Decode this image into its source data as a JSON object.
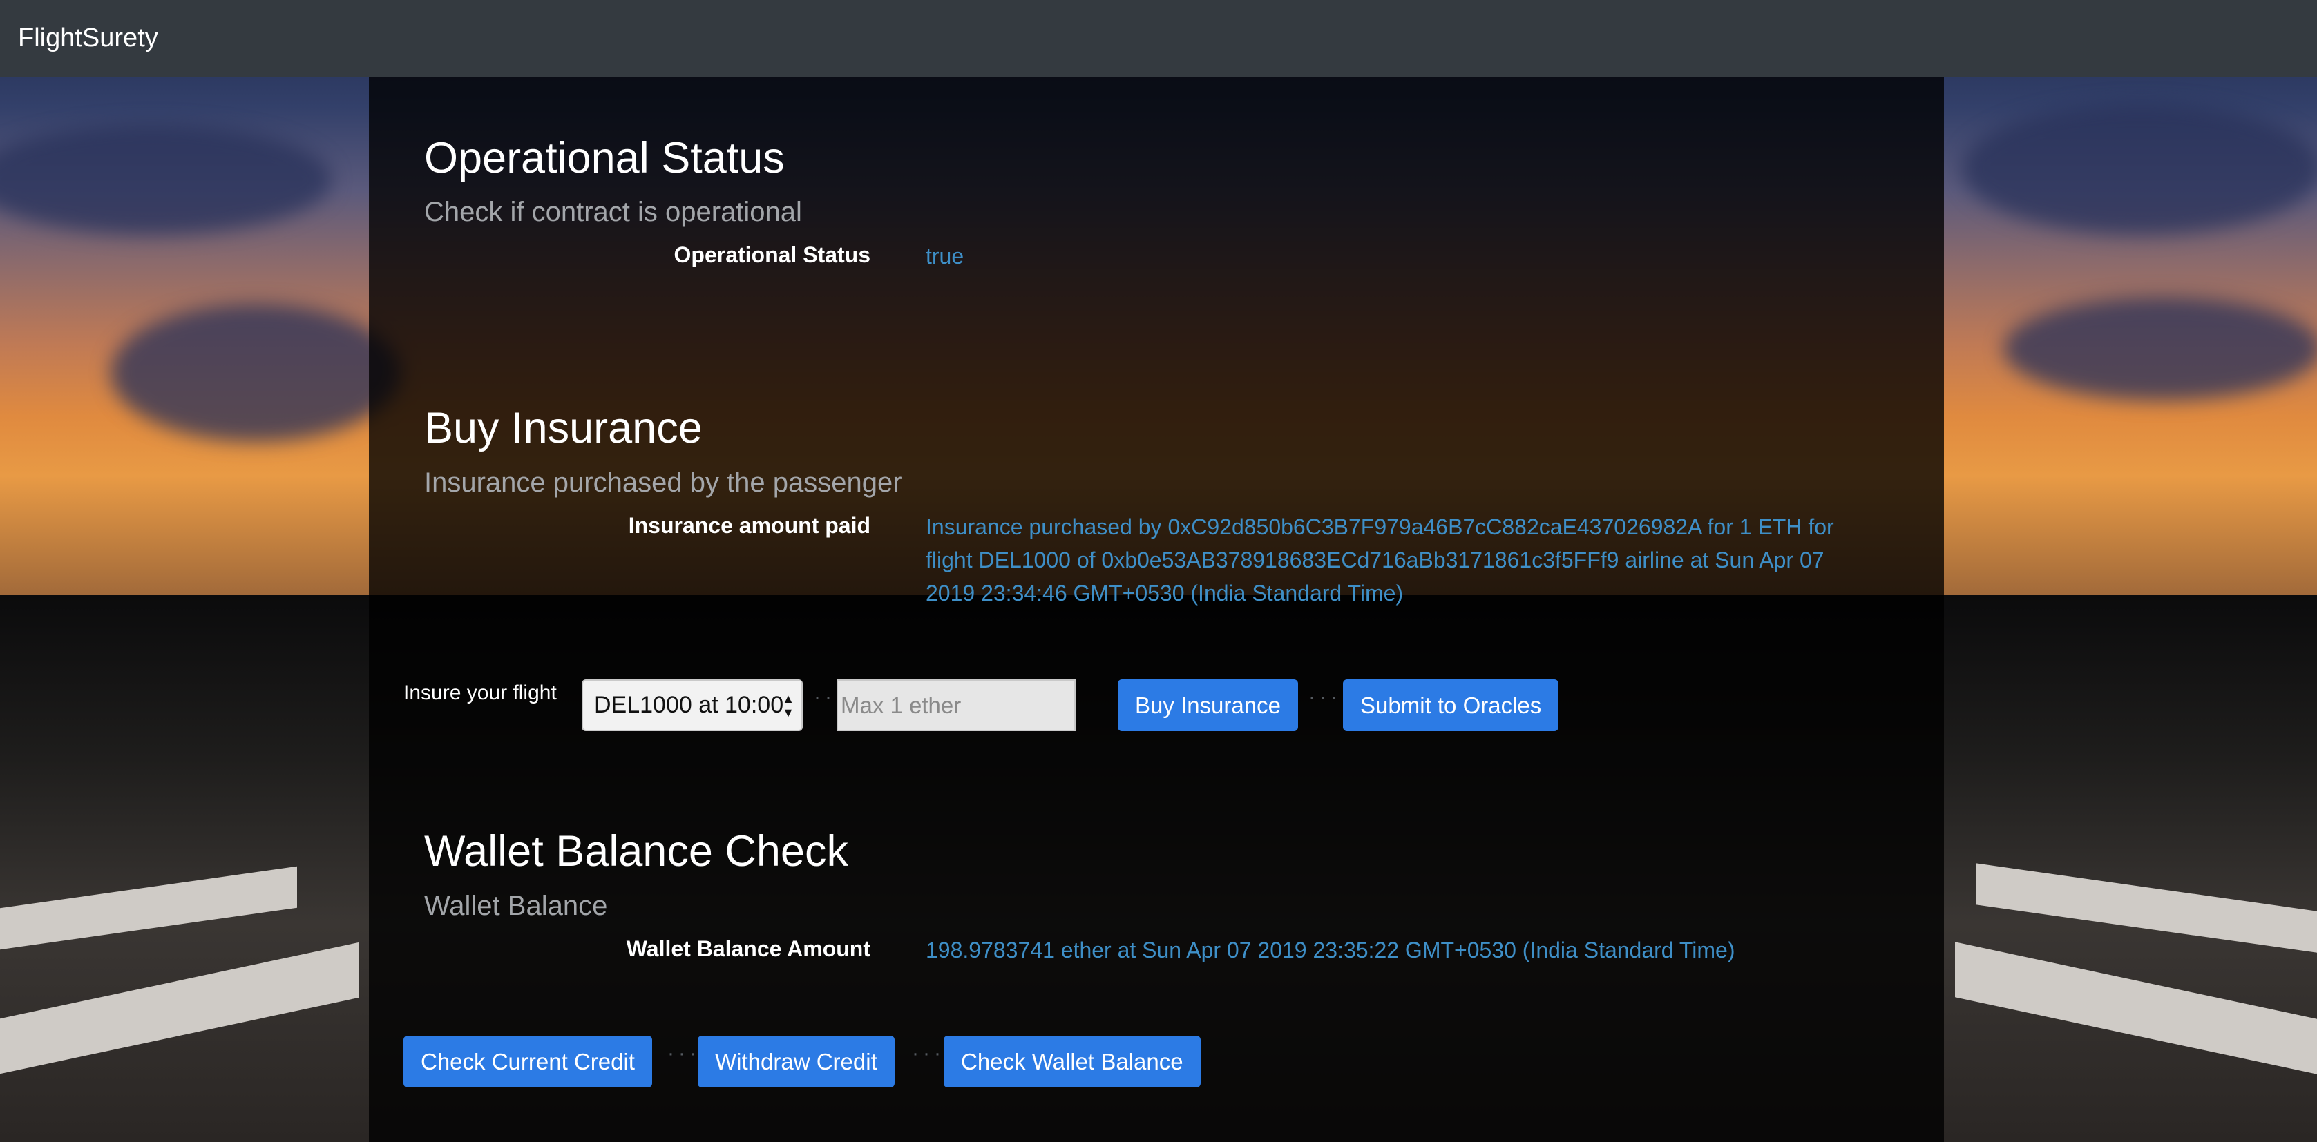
{
  "navbar": {
    "brand": "FlightSurety"
  },
  "operational": {
    "title": "Operational Status",
    "subtitle": "Check if contract is operational",
    "label": "Operational Status",
    "value": "true"
  },
  "insurance": {
    "title": "Buy Insurance",
    "subtitle": "Insurance purchased by the passenger",
    "label": "Insurance amount paid",
    "value_line1": "Insurance purchased by 0xC92d850b6C3B7F979a46B7cC882caE437026982A for 1 ETH for",
    "value_line2": "flight DEL1000 of 0xb0e53AB378918683ECd716aBb3171861c3f5FFf9 airline at Sun Apr 07",
    "value_line3": "2019 23:34:46 GMT+0530 (India Standard Time)"
  },
  "insure_form": {
    "label": "Insure your flight",
    "flight_select": "DEL1000 at 10:00",
    "amount_placeholder": "Max 1 ether",
    "buy_button": "Buy Insurance",
    "oracles_button": "Submit to Oracles"
  },
  "wallet": {
    "title": "Wallet Balance Check",
    "subtitle": "Wallet Balance",
    "label": "Wallet Balance Amount",
    "value": "198.9783741 ether at Sun Apr 07 2019 23:35:22 GMT+0530 (India Standard Time)"
  },
  "actions": {
    "check_credit": "Check Current Credit",
    "withdraw": "Withdraw Credit",
    "check_wallet": "Check Wallet Balance"
  },
  "icons": {
    "select_arrows": "up-down-arrows-icon"
  }
}
